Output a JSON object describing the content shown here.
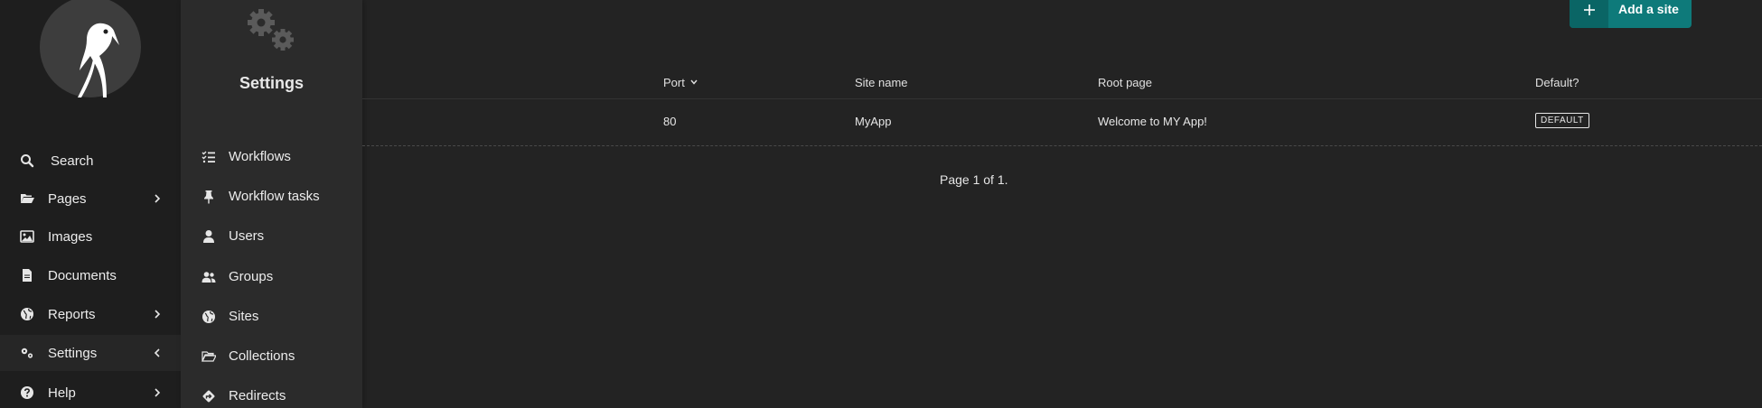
{
  "sidebar": {
    "items": [
      {
        "label": "Search",
        "icon": "search-icon"
      },
      {
        "label": "Pages",
        "icon": "folder-open-icon"
      },
      {
        "label": "Images",
        "icon": "image-icon"
      },
      {
        "label": "Documents",
        "icon": "document-icon"
      },
      {
        "label": "Reports",
        "icon": "globe-icon"
      },
      {
        "label": "Settings",
        "icon": "cogs-icon"
      },
      {
        "label": "Help",
        "icon": "help-icon"
      }
    ]
  },
  "submenu": {
    "title": "Settings",
    "items": [
      {
        "label": "Workflows",
        "icon": "tasks-icon"
      },
      {
        "label": "Workflow tasks",
        "icon": "thumbtack-icon"
      },
      {
        "label": "Users",
        "icon": "user-icon"
      },
      {
        "label": "Groups",
        "icon": "group-icon"
      },
      {
        "label": "Sites",
        "icon": "globe-icon"
      },
      {
        "label": "Collections",
        "icon": "folder-open-icon"
      },
      {
        "label": "Redirects",
        "icon": "redirect-icon"
      }
    ]
  },
  "toolbar": {
    "add_label": "Add a site"
  },
  "table": {
    "headers": {
      "port": "Port",
      "site_name": "Site name",
      "root_page": "Root page",
      "default": "Default?"
    },
    "rows": [
      {
        "port": "80",
        "site_name": "MyApp",
        "root_page": "Welcome to MY App!",
        "default": "DEFAULT"
      }
    ]
  },
  "pagination": {
    "text": "Page 1 of 1."
  },
  "colors": {
    "accent": "#0e7a7a",
    "background": "#232323",
    "sidebar": "#1e1e1e",
    "submenu": "#2b2b2b"
  }
}
